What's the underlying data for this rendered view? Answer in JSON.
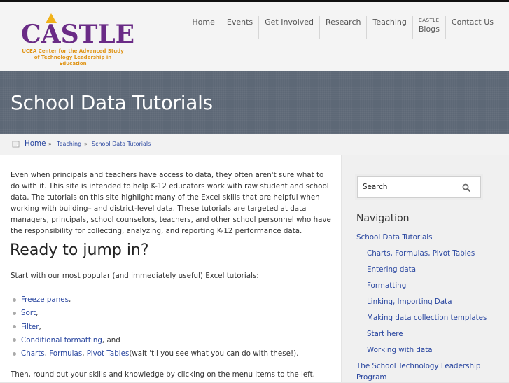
{
  "header": {
    "logo": {
      "word": "CASTLE",
      "sub_line1": "UCEA Center for the Advanced Study",
      "sub_line2": "of Technology Leadership in Education"
    },
    "nav": [
      {
        "small": "",
        "label": "Home"
      },
      {
        "small": "",
        "label": "Events"
      },
      {
        "small": "",
        "label": "Get Involved"
      },
      {
        "small": "",
        "label": "Research"
      },
      {
        "small": "",
        "label": "Teaching"
      },
      {
        "small": "CASTLE",
        "label": "Blogs"
      },
      {
        "small": "",
        "label": "Contact Us"
      }
    ]
  },
  "hero": {
    "title": "School Data Tutorials"
  },
  "breadcrumb": {
    "home": "Home",
    "sep": "»",
    "teaching": "Teaching",
    "current": "School Data Tutorials"
  },
  "main": {
    "intro": "Even when principals and teachers have access to data, they often aren't sure what to do with it. This site is intended to help K-12 educators work with raw student and school data. The tutorials on this site highlight many of the Excel skills that are helpful when working with building– and district-level data. These tutorials are targeted at data managers, principals, school counselors, teachers, and other school personnel who have the responsibility for collecting, analyzing, and reporting K-12 performance data.",
    "heading": "Ready to jump in?",
    "lead": "Start with our most popular (and immediately useful) Excel tutorials:",
    "list": {
      "freeze": "Freeze panes",
      "sort": "Sort",
      "filter": "Filter",
      "cond": "Conditional formatting",
      "and": "and",
      "charts": "Charts",
      "formulas": "Formulas",
      "pivot": "Pivot Tables",
      "tail": "(wait 'til you see what you can do with these!)."
    },
    "outro": "Then, round out your skills and knowledge by clicking on the menu items to the left."
  },
  "sidebar": {
    "search_placeholder": "Search",
    "nav_title": "Navigation",
    "items": [
      "School Data Tutorials",
      "Charts, Formulas, Pivot Tables",
      "Entering data",
      "Formatting",
      "Linking, Importing Data",
      "Making data collection templates",
      "Start here",
      "Working with data",
      "The School Technology Leadership Program"
    ]
  },
  "colors": {
    "link": "#2a47a0",
    "brand_purple": "#6a2b86",
    "brand_gold": "#e0961a",
    "hero_bg": "#5d6876"
  }
}
